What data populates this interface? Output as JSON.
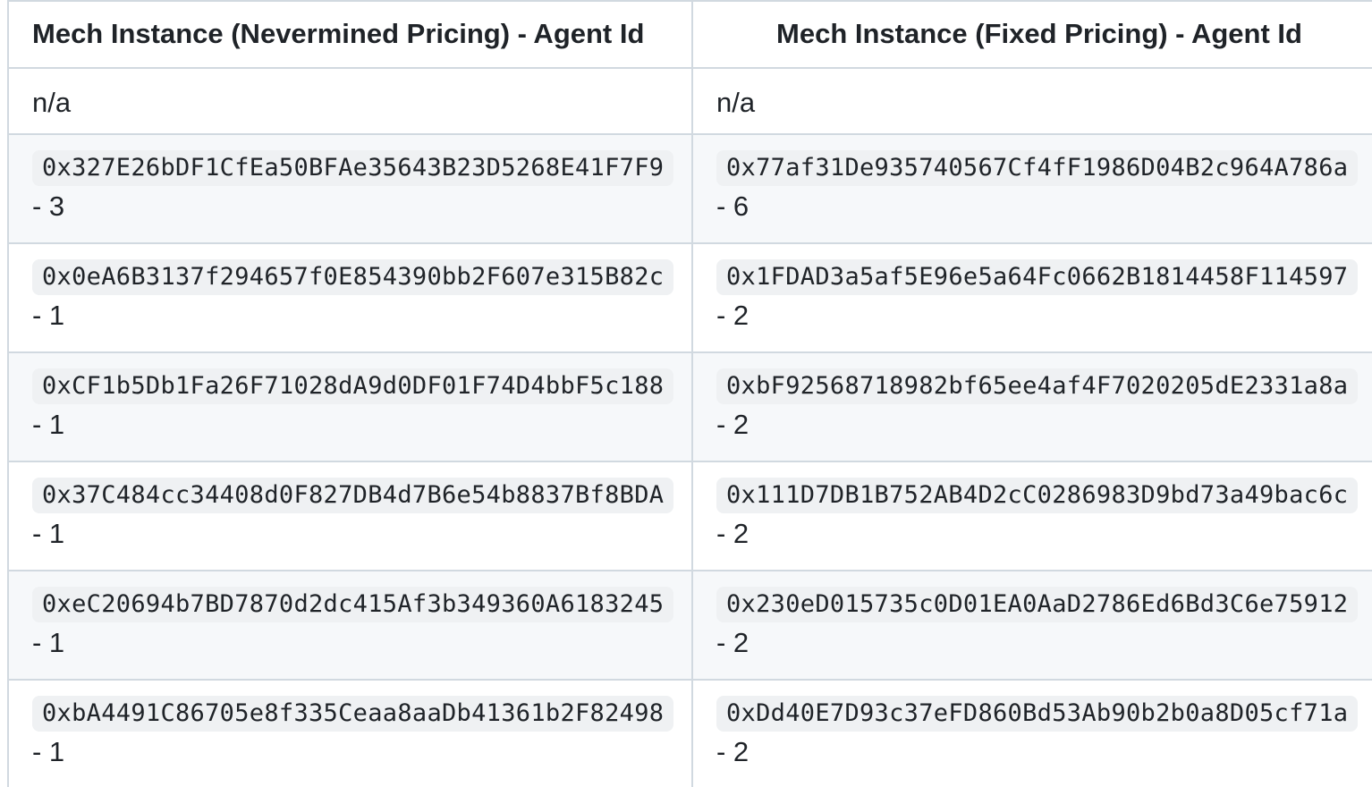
{
  "table": {
    "headers": [
      "Mech Instance (Nevermined Pricing) - Agent Id",
      "Mech Instance (Fixed Pricing) - Agent Id"
    ],
    "rows": [
      {
        "nevermined": {
          "text": "n/a"
        },
        "fixed": {
          "text": "n/a"
        }
      },
      {
        "nevermined": {
          "address": "0x327E26bDF1CfEa50BFAe35643B23D5268E41F7F9",
          "agent_id": "- 3"
        },
        "fixed": {
          "address": "0x77af31De935740567Cf4fF1986D04B2c964A786a",
          "agent_id": "- 6"
        }
      },
      {
        "nevermined": {
          "address": "0x0eA6B3137f294657f0E854390bb2F607e315B82c",
          "agent_id": "- 1"
        },
        "fixed": {
          "address": "0x1FDAD3a5af5E96e5a64Fc0662B1814458F114597",
          "agent_id": "- 2"
        }
      },
      {
        "nevermined": {
          "address": "0xCF1b5Db1Fa26F71028dA9d0DF01F74D4bbF5c188",
          "agent_id": "- 1"
        },
        "fixed": {
          "address": "0xbF92568718982bf65ee4af4F7020205dE2331a8a",
          "agent_id": "- 2"
        }
      },
      {
        "nevermined": {
          "address": "0x37C484cc34408d0F827DB4d7B6e54b8837Bf8BDA",
          "agent_id": "- 1"
        },
        "fixed": {
          "address": "0x111D7DB1B752AB4D2cC0286983D9bd73a49bac6c",
          "agent_id": "- 2"
        }
      },
      {
        "nevermined": {
          "address": "0xeC20694b7BD7870d2dc415Af3b349360A6183245",
          "agent_id": "- 1"
        },
        "fixed": {
          "address": "0x230eD015735c0D01EA0AaD2786Ed6Bd3C6e75912",
          "agent_id": "- 2"
        }
      },
      {
        "nevermined": {
          "address": "0xbA4491C86705e8f335Ceaa8aaDb41361b2F82498",
          "agent_id": "- 1"
        },
        "fixed": {
          "address": "0xDd40E7D93c37eFD860Bd53Ab90b2b0a8D05cf71a",
          "agent_id": "- 2"
        }
      }
    ]
  },
  "colors": {
    "border": "#d1d9e0",
    "row_shade": "#f6f8fa",
    "code_background": "#eff1f3",
    "text": "#1f2328"
  }
}
